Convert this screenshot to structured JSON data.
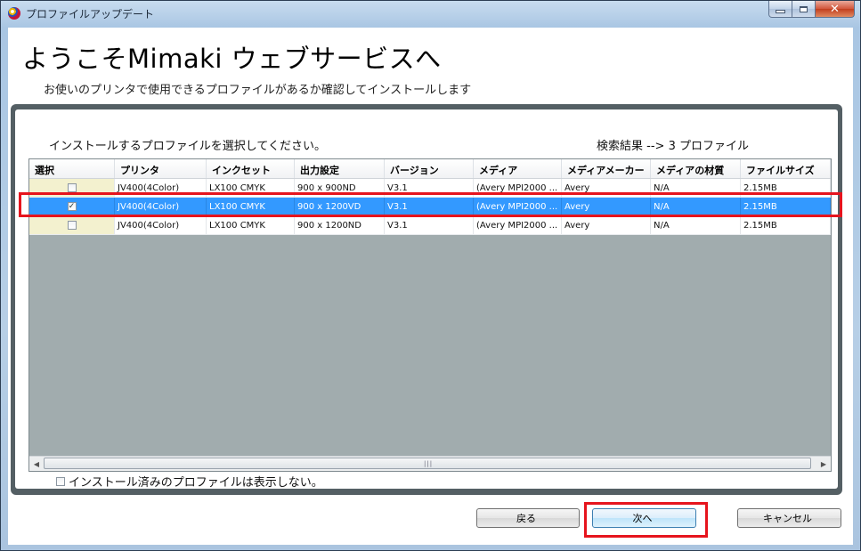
{
  "window": {
    "title": "プロファイルアップデート",
    "controls": {
      "minimize_icon": "minimize-icon",
      "maximize_icon": "maximize-icon",
      "close_icon": "close-icon"
    }
  },
  "header": {
    "title": "ようこそMimaki ウェブサービスへ",
    "subtitle": "お使いのプリンタで使用できるプロファイルがあるか確認してインストールします"
  },
  "panel": {
    "prompt": "インストールするプロファイルを選択してください。",
    "result": "検索結果 --> 3 プロファイル"
  },
  "table": {
    "columns": [
      "選択",
      "プリンタ",
      "インクセット",
      "出力設定",
      "バージョン",
      "メディア",
      "メディアメーカー",
      "メディアの材質",
      "ファイルサイズ"
    ],
    "rows": [
      {
        "checked": false,
        "selected": false,
        "cells": [
          "JV400(4Color)",
          "LX100 CMYK",
          "900 x 900ND",
          "V3.1",
          "(Avery MPI2000 ...",
          "Avery",
          "N/A",
          "2.15MB"
        ]
      },
      {
        "checked": true,
        "selected": true,
        "cells": [
          "JV400(4Color)",
          "LX100 CMYK",
          "900 x 1200VD",
          "V3.1",
          "(Avery MPI2000 ...",
          "Avery",
          "N/A",
          "2.15MB"
        ]
      },
      {
        "checked": false,
        "selected": false,
        "cells": [
          "JV400(4Color)",
          "LX100 CMYK",
          "900 x 1200ND",
          "V3.1",
          "(Avery MPI2000 ...",
          "Avery",
          "N/A",
          "2.15MB"
        ]
      }
    ]
  },
  "options": {
    "hide_installed_label": "インストール済みのプロファイルは表示しない。",
    "hide_installed_checked": false
  },
  "buttons": {
    "back": "戻る",
    "next": "次へ",
    "cancel": "キャンセル"
  },
  "colors": {
    "selection": "#3399ff",
    "highlight_box": "#e6141d",
    "panel_frame": "#545f64",
    "grid_background": "#a1acae"
  }
}
